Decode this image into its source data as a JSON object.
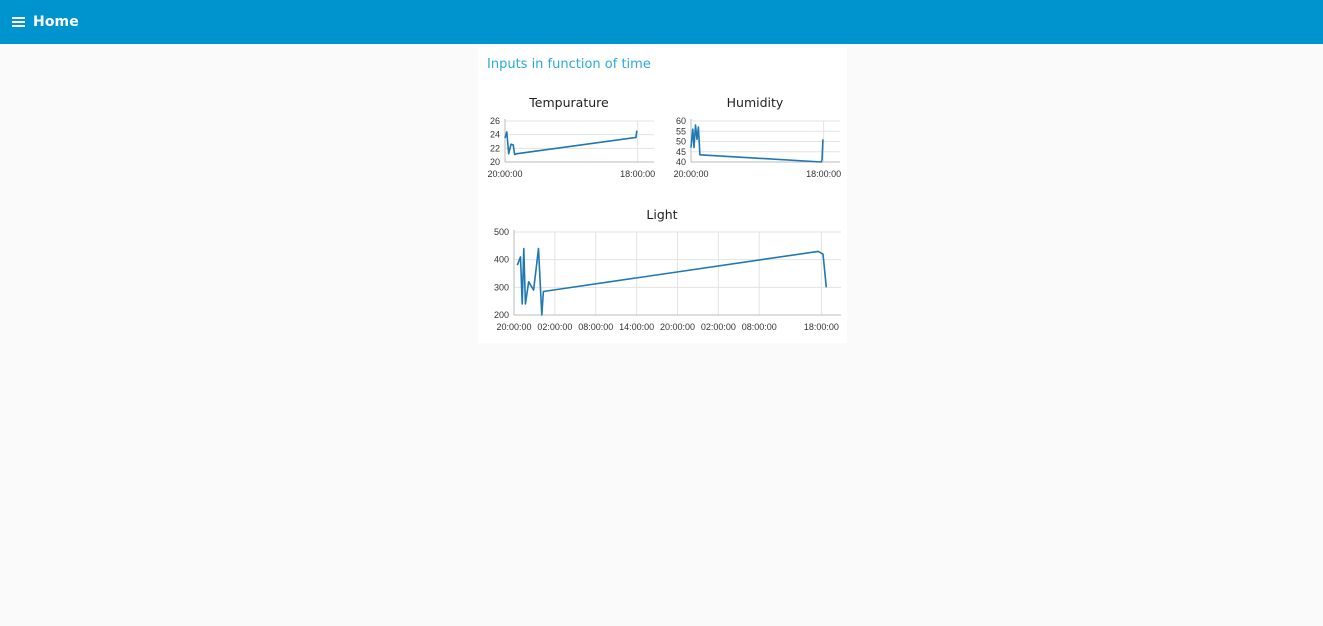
{
  "header": {
    "menu_icon": "hamburger-menu-icon",
    "title": "Home",
    "color": "#0094ce"
  },
  "group": {
    "title": "Inputs in function of time",
    "title_color": "#2aa9e0"
  },
  "chart_data": [
    {
      "id": "temperature",
      "type": "line",
      "title": "Tempurature",
      "xlabel": "",
      "ylabel": "",
      "ylim": [
        20,
        26
      ],
      "y_ticks": [
        "20",
        "22",
        "24",
        "26"
      ],
      "x_ticks": [
        "20:00:00",
        "18:00:00"
      ],
      "grid": true,
      "line_color": "#1f77b4",
      "series": [
        {
          "values": [
            23.5,
            24.4,
            21.2,
            22.6,
            22.5,
            21.1,
            21.2,
            23.6,
            23.8,
            24.6
          ]
        }
      ]
    },
    {
      "id": "humidity",
      "type": "line",
      "title": "Humidity",
      "xlabel": "",
      "ylabel": "",
      "ylim": [
        40,
        60
      ],
      "y_ticks": [
        "40",
        "45",
        "50",
        "55",
        "60"
      ],
      "x_ticks": [
        "20:00:00",
        "18:00:00"
      ],
      "grid": true,
      "line_color": "#1f77b4",
      "series": [
        {
          "values": [
            47,
            56,
            47,
            58,
            51,
            57,
            43.5,
            43.5,
            40,
            41.5,
            51
          ]
        }
      ]
    },
    {
      "id": "light",
      "type": "line",
      "title": "Light",
      "xlabel": "",
      "ylabel": "",
      "ylim": [
        200,
        500
      ],
      "y_ticks": [
        "200",
        "300",
        "400",
        "500"
      ],
      "x_ticks": [
        "20:00:00",
        "02:00:00",
        "08:00:00",
        "14:00:00",
        "20:00:00",
        "02:00:00",
        "08:00:00",
        "18:00:00"
      ],
      "grid": true,
      "line_color": "#1f77b4",
      "series": [
        {
          "values": [
            380,
            410,
            240,
            440,
            240,
            320,
            290,
            440,
            200,
            285,
            430,
            420,
            300
          ]
        }
      ]
    }
  ]
}
